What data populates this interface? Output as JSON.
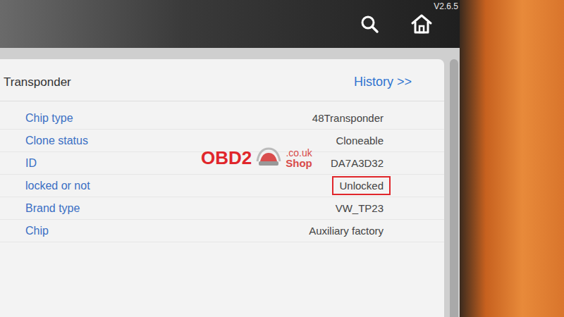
{
  "topbar": {
    "version": "V2.6.5"
  },
  "panel": {
    "title": "Transponder",
    "history_link": "History >>"
  },
  "rows": [
    {
      "label": "Chip type",
      "value": "48Transponder",
      "highlighted": false
    },
    {
      "label": "Clone status",
      "value": "Cloneable",
      "highlighted": false
    },
    {
      "label": "ID",
      "value": "DA7A3D32",
      "highlighted": false
    },
    {
      "label": "locked or not",
      "value": "Unlocked",
      "highlighted": true
    },
    {
      "label": "Brand type",
      "value": "VW_TP23",
      "highlighted": false
    },
    {
      "label": "Chip",
      "value": "Auxiliary factory",
      "highlighted": false
    }
  ],
  "watermark": {
    "brand": "OBD2",
    "shop": "Shop",
    "domain": ".co.uk"
  }
}
